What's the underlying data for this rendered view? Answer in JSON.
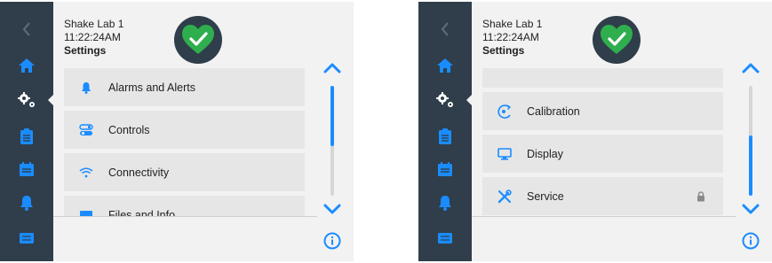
{
  "colors": {
    "accent": "#1a8cff",
    "sidebar": "#2f3e4a",
    "status_ok": "#2fae4e",
    "panel": "#f2f2f2",
    "row": "#e6e6e6"
  },
  "screens": [
    {
      "header": {
        "device": "Shake Lab 1",
        "time": "11:22:24AM",
        "title": "Settings"
      },
      "status_icon": "heart-check-icon",
      "list": [
        {
          "label": "Alarms and Alerts",
          "icon": "bell-icon",
          "locked": false
        },
        {
          "label": "Controls",
          "icon": "toggle-icon",
          "locked": false
        },
        {
          "label": "Connectivity",
          "icon": "wifi-icon",
          "locked": false
        },
        {
          "label": "Files and Info",
          "icon": "files-icon",
          "locked": false
        }
      ],
      "scroll_position": 0.0,
      "scroll_visible_fraction": 0.55
    },
    {
      "header": {
        "device": "Shake Lab 1",
        "time": "11:22:24AM",
        "title": "Settings"
      },
      "status_icon": "heart-check-icon",
      "list": [
        {
          "label": "",
          "icon": "",
          "locked": false
        },
        {
          "label": "Calibration",
          "icon": "calibration-icon",
          "locked": false
        },
        {
          "label": "Display",
          "icon": "monitor-icon",
          "locked": false
        },
        {
          "label": "Service",
          "icon": "tools-icon",
          "locked": true
        }
      ],
      "scroll_position": 1.0,
      "scroll_visible_fraction": 0.55
    }
  ],
  "sidebar_icons": [
    "back-icon",
    "home-icon",
    "settings-icon",
    "clipboard-icon",
    "calendar-icon",
    "bell-icon",
    "keyboard-icon"
  ]
}
